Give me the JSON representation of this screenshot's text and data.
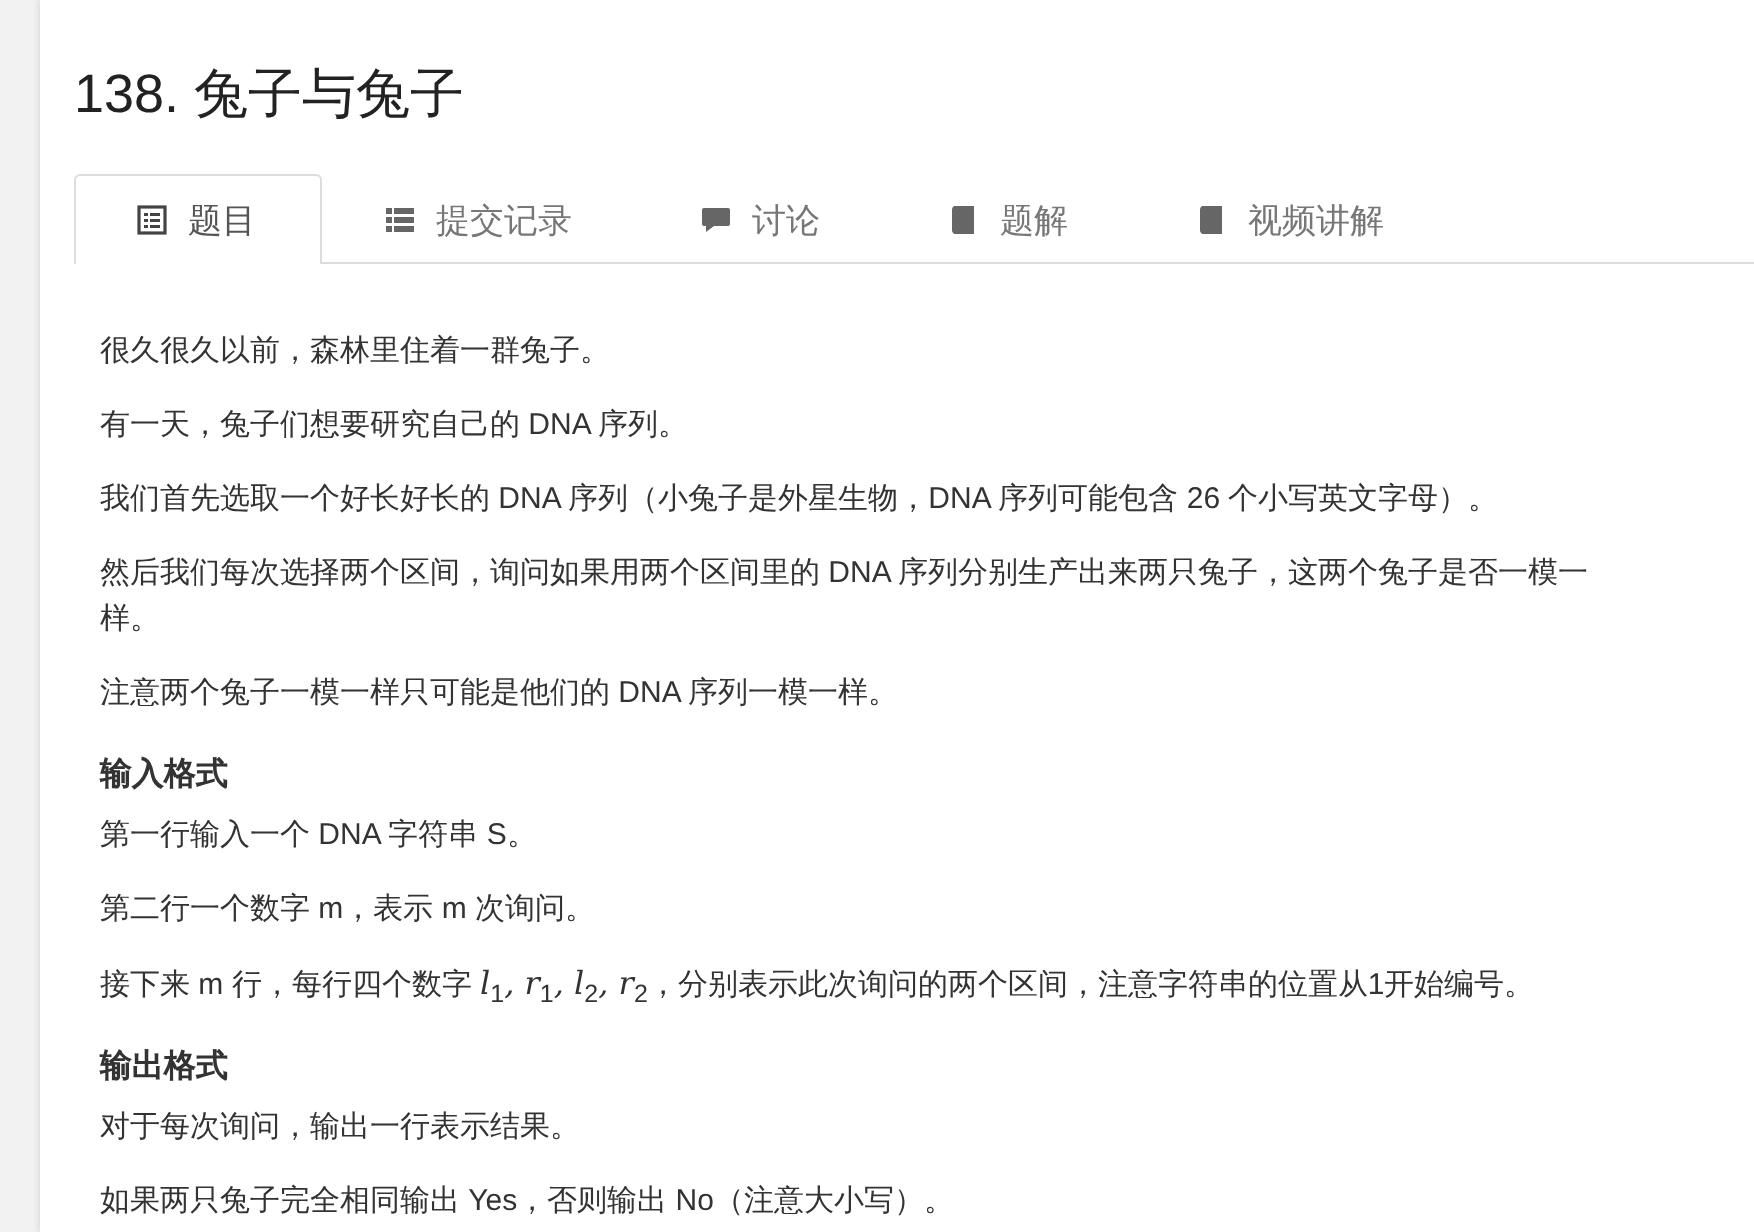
{
  "title": "138. 兔子与兔子",
  "tabs": [
    {
      "label": "题目",
      "kind": "list-box",
      "selected": true
    },
    {
      "label": "提交记录",
      "kind": "list",
      "selected": false
    },
    {
      "label": "讨论",
      "kind": "comment",
      "selected": false
    },
    {
      "label": "题解",
      "kind": "book",
      "selected": false
    },
    {
      "label": "视频讲解",
      "kind": "book",
      "selected": false
    }
  ],
  "content": [
    {
      "kind": "paragraph",
      "text": "很久很久以前，森林里住着一群兔子。"
    },
    {
      "kind": "paragraph",
      "text": "有一天，兔子们想要研究自己的 DNA 序列。"
    },
    {
      "kind": "paragraph",
      "text": "我们首先选取一个好长好长的 DNA 序列（小兔子是外星生物，DNA 序列可能包含 26 个小写英文字母）。"
    },
    {
      "kind": "paragraph",
      "text": "然后我们每次选择两个区间，询问如果用两个区间里的 DNA 序列分别生产出来两只兔子，这两个兔子是否一模一样。"
    },
    {
      "kind": "paragraph",
      "text": "注意两个兔子一模一样只可能是他们的 DNA 序列一模一样。"
    },
    {
      "kind": "heading",
      "text": "输入格式"
    },
    {
      "kind": "paragraph",
      "text": "第一行输入一个 DNA 字符串 S。"
    },
    {
      "kind": "paragraph",
      "text": "第二行一个数字 m，表示 m 次询问。"
    },
    {
      "kind": "paragraph",
      "text": "接下来 m 行，每行四个数字 *l*$_{1}$*, r*$_{1}$*, l*$_{2}$*, r*$_{2}$，分别表示此次询问的两个区间，注意字符串的位置从1开始编号。"
    },
    {
      "kind": "heading",
      "text": "输出格式"
    },
    {
      "kind": "paragraph",
      "text": "对于每次询问，输出一行表示结果。"
    },
    {
      "kind": "paragraph",
      "text": "如果两只兔子完全相同输出 Yes，否则输出 No（注意大小写）。"
    }
  ]
}
